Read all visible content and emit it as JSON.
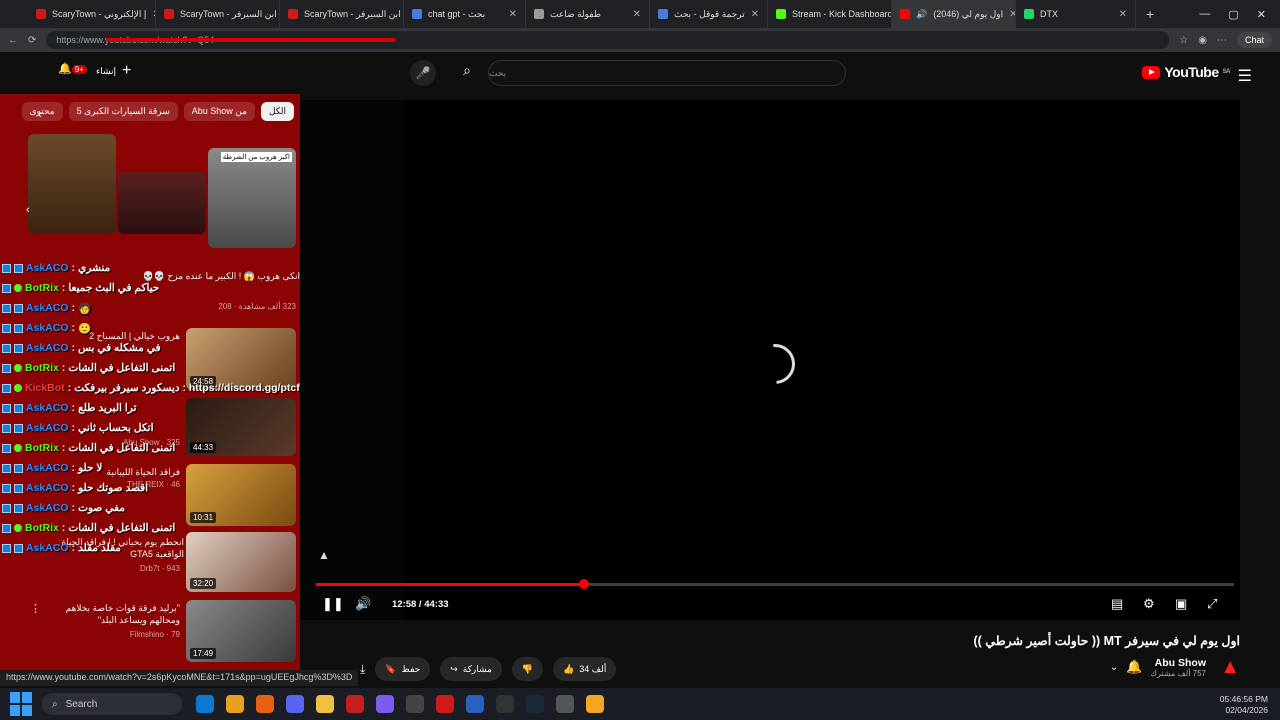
{
  "browser": {
    "tabs": [
      {
        "label": "ScaryTown - إ الإلكتروني",
        "color": "#cc1b1b"
      },
      {
        "label": "ScaryTown - ابن السيرفر",
        "color": "#cc1b1b"
      },
      {
        "label": "ScaryTown - ابن السيرفر",
        "color": "#cc1b1b"
      },
      {
        "label": "chat gpt - بحث",
        "color": "#4a7ce0"
      },
      {
        "label": "",
        "color": "#999999"
      },
      {
        "label": "طفولة ضاعت",
        "color": "#f0a020"
      },
      {
        "label": "ترجمة قوقل - بحث",
        "color": "#4a7ce0"
      },
      {
        "label": "Stream - Kick Dashboard",
        "color": "#53fc18"
      },
      {
        "label": "(2046) اول يوم لي",
        "color": "#ff0000"
      },
      {
        "label": "DTX",
        "color": "#25d366"
      }
    ],
    "url": "https://www.youtube.com/watch?v=Q54",
    "chat_button": "Chat"
  },
  "masthead": {
    "logo": "YouTube",
    "logo_region": "SA",
    "search_placeholder": "بحث",
    "create_label": "إنشاء",
    "notif_count": "9+"
  },
  "chips": [
    "الكل",
    "من Abu Show",
    "سرقة السيارات الكبرى 5",
    "محتوى"
  ],
  "recommendations": [
    {
      "title": "اكبر هروب من الشرطة",
      "meta": "",
      "duration": ""
    },
    {
      "title": "انكى هروب 😱 ! الكبير ما عنده مزح 💀💀",
      "meta": "323 ألف مشاهدة · 208",
      "duration": ""
    },
    {
      "title": "هروب خيالي | المسباح 2",
      "meta": "",
      "duration": "24:58"
    },
    {
      "title": "هل يتحمل العسكرية ؟",
      "meta": "Abu Show · 325",
      "duration": "44:33"
    },
    {
      "title": "فراقد الحياة الليبانية",
      "meta": "THE REIX · 46",
      "duration": "10:31"
    },
    {
      "title": "انحطم يوم بحياتي ! | فراقد الحياة الواقعية GTA5",
      "meta": "Drb7t · 943",
      "duration": "32:20"
    },
    {
      "title": "\"برليد فرقة قوات خاصة بخلاهم ومحالهم ويساعد البلد\"",
      "meta": "Filmshino · 79",
      "duration": "17:49"
    }
  ],
  "chat": [
    {
      "user": "AskACO",
      "type": "ask",
      "msg": "منشري"
    },
    {
      "user": "BotRix",
      "type": "bot",
      "msg": "حياكم في البث جميعا"
    },
    {
      "user": "AskACO",
      "type": "ask",
      "msg": "🧑"
    },
    {
      "user": "AskACO",
      "type": "ask",
      "msg": "🙂"
    },
    {
      "user": "AskACO",
      "type": "ask",
      "msg": "في مشكله في بس"
    },
    {
      "user": "BotRix",
      "type": "bot",
      "msg": "اتمنى التفاعل في الشات"
    },
    {
      "user": "KickBot",
      "type": "kick",
      "msg": "ديسكورد سيرفر بيرفكت : https://discord.gg/ptcfw"
    },
    {
      "user": "AskACO",
      "type": "ask",
      "msg": "ترا البريد طلع"
    },
    {
      "user": "AskACO",
      "type": "ask",
      "msg": "اتكل بحساب ثاني"
    },
    {
      "user": "BotRix",
      "type": "bot",
      "msg": "اتمنى التفاعل في الشات"
    },
    {
      "user": "AskACO",
      "type": "ask",
      "msg": "لا حلو"
    },
    {
      "user": "AskACO",
      "type": "ask",
      "msg": "اقصد صوتك حلو"
    },
    {
      "user": "AskACO",
      "type": "ask",
      "msg": "مفي صوت"
    },
    {
      "user": "BotRix",
      "type": "bot",
      "msg": "اتمنى التفاعل في الشات"
    },
    {
      "user": "AskACO",
      "type": "ask",
      "msg": "مقلد مقلد"
    }
  ],
  "player": {
    "time": "12:58 / 44:33",
    "progress": 0.2914
  },
  "video": {
    "title": "اول يوم لي في سيرفر MT (( حاولت أصير شرطي ))",
    "channel": "Abu Show",
    "subs": "757 ألف مشترك",
    "likes": "34 ألف",
    "share": "مشاركة",
    "save": "حفظ"
  },
  "status_url": "https://www.youtube.com/watch?v=2s6pKycoMNE&t=171s&pp=ugUEEgJhcg%3D%3D",
  "taskbar": {
    "search": "Search",
    "time": "05:46:56 PM",
    "date": "02/04/2026"
  }
}
